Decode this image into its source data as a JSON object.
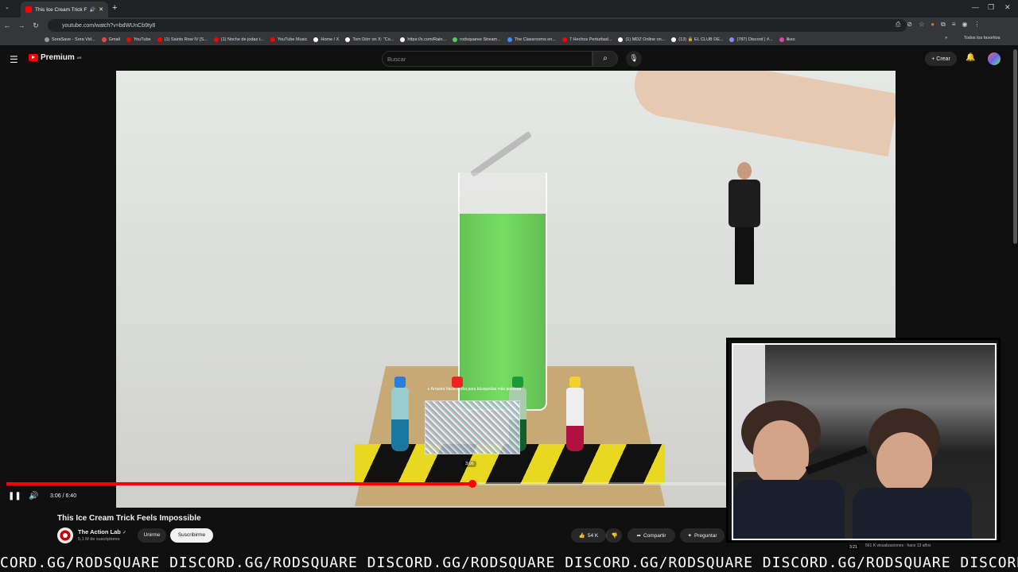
{
  "browser": {
    "tab_title": "This Ice Cream Trick Feels I",
    "url": "youtube.com/watch?v=bdWUnCb9ty8",
    "bookmarks": [
      "SoraSave - Sora Vid...",
      "Gmail",
      "YouTube",
      "(1) Saints Row IV [S...",
      "(1) Noche de jodas t...",
      "YouTube Music",
      "Home / X",
      "Tom Dörr on X: \"Co...",
      "https://x.com/Rain...",
      "rodsquaree Stream...",
      "The Classrooms en...",
      "7 Hechos Perturbad...",
      "(1) MDZ Online on...",
      "(13) 🔒 EL CLUB DE...",
      "(787) Discord | #...",
      "likes"
    ],
    "bookmarks_other": "Todos los favoritos"
  },
  "youtube": {
    "logo_text": "Premium",
    "logo_region": "AR",
    "search_placeholder": "Buscar",
    "create_label": "Crear"
  },
  "video": {
    "title": "This Ice Cream Trick Feels Impossible",
    "current_time": "3:06 / 6:40",
    "progress_fraction": 0.648,
    "hover_hint": "∧ Arrastra hacia arriba para búsquedas más precisas",
    "hover_time": "3:06"
  },
  "channel": {
    "name": "The Action Lab",
    "verified": "✓",
    "subscribers": "5,1 M de suscriptores",
    "join_label": "Unirme",
    "subscribe_label": "Suscribirme"
  },
  "actions": {
    "likes": "54 K",
    "share_label": "Compartir",
    "ask_label": "Preguntar"
  },
  "sidebar_peek": {
    "views": "561 K visualizaciones · hace 13 años",
    "duration": "3:21"
  },
  "ticker_text": "CORD.GG/RODSQUARE DISCORD.GG/RODSQUARE DISCORD.GG/RODSQUARE DISCORD.GG/RODSQUARE DISCORD.GG/RODSQUARE DISCORD.GG/RODSQUARE DIDIS"
}
